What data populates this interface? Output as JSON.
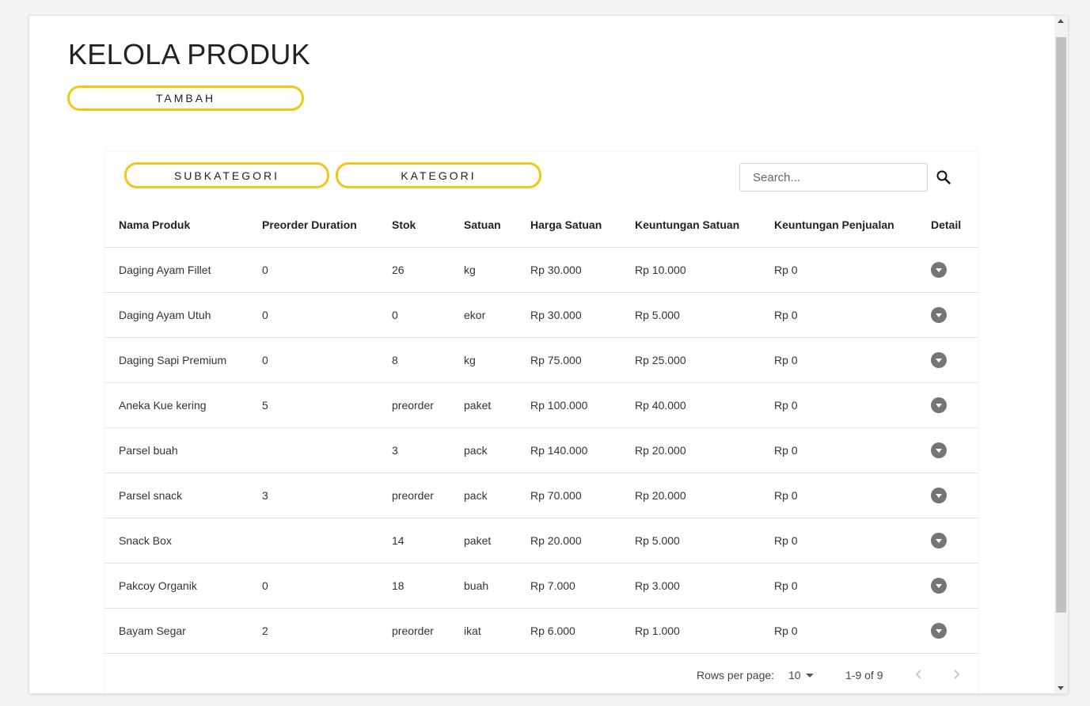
{
  "page": {
    "title": "KELOLA PRODUK",
    "add_button": "TAMBAH"
  },
  "toolbar": {
    "subkategori_button": "SUBKATEGORI",
    "kategori_button": "KATEGORI",
    "search_placeholder": "Search...",
    "search_icon": "search-icon"
  },
  "table": {
    "columns": [
      "Nama Produk",
      "Preorder Duration",
      "Stok",
      "Satuan",
      "Harga Satuan",
      "Keuntungan Satuan",
      "Keuntungan Penjualan",
      "Detail"
    ],
    "rows": [
      {
        "nama": "Daging Ayam Fillet",
        "preorder": "0",
        "stok": "26",
        "satuan": "kg",
        "harga": "Rp 30.000",
        "keuntungan": "Rp 10.000",
        "penjualan": "Rp 0"
      },
      {
        "nama": "Daging Ayam Utuh",
        "preorder": "0",
        "stok": "0",
        "satuan": "ekor",
        "harga": "Rp 30.000",
        "keuntungan": "Rp 5.000",
        "penjualan": "Rp 0"
      },
      {
        "nama": "Daging Sapi Premium",
        "preorder": "0",
        "stok": "8",
        "satuan": "kg",
        "harga": "Rp 75.000",
        "keuntungan": "Rp 25.000",
        "penjualan": "Rp 0"
      },
      {
        "nama": "Aneka Kue kering",
        "preorder": "5",
        "stok": "preorder",
        "satuan": "paket",
        "harga": "Rp 100.000",
        "keuntungan": "Rp 40.000",
        "penjualan": "Rp 0"
      },
      {
        "nama": "Parsel buah",
        "preorder": "",
        "stok": "3",
        "satuan": "pack",
        "harga": "Rp 140.000",
        "keuntungan": "Rp 20.000",
        "penjualan": "Rp 0"
      },
      {
        "nama": "Parsel snack",
        "preorder": "3",
        "stok": "preorder",
        "satuan": "pack",
        "harga": "Rp 70.000",
        "keuntungan": "Rp 20.000",
        "penjualan": "Rp 0"
      },
      {
        "nama": "Snack Box",
        "preorder": "",
        "stok": "14",
        "satuan": "paket",
        "harga": "Rp 20.000",
        "keuntungan": "Rp 5.000",
        "penjualan": "Rp 0"
      },
      {
        "nama": "Pakcoy Organik",
        "preorder": "0",
        "stok": "18",
        "satuan": "buah",
        "harga": "Rp 7.000",
        "keuntungan": "Rp 3.000",
        "penjualan": "Rp 0"
      },
      {
        "nama": "Bayam Segar",
        "preorder": "2",
        "stok": "preorder",
        "satuan": "ikat",
        "harga": "Rp 6.000",
        "keuntungan": "Rp 1.000",
        "penjualan": "Rp 0"
      }
    ]
  },
  "pagination": {
    "rows_per_page_label": "Rows per page:",
    "rows_per_page_value": "10",
    "range": "1-9 of 9"
  },
  "colors": {
    "accent": "#f5c518",
    "detail_button": "#757575"
  }
}
